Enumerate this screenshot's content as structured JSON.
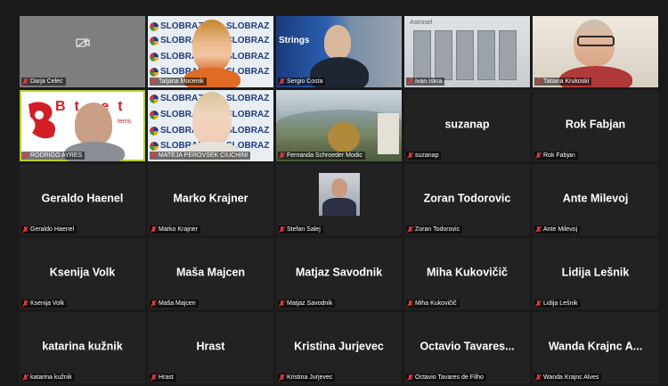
{
  "colors": {
    "active_border": "#b5d12a",
    "muted_mic": "#e03a3a",
    "tile_bg": "#222222"
  },
  "tiles": [
    {
      "id": "darja",
      "name": "Darja Celec",
      "label": "Darja Celec",
      "video": "camera-off"
    },
    {
      "id": "tatjana",
      "name": "Tatjana Mocenik",
      "label": "Tatjana Mocenik",
      "video": "slobraz"
    },
    {
      "id": "sergio",
      "name": "Sergio Costa",
      "label": "Sergio Costa",
      "video": "strings"
    },
    {
      "id": "ivan",
      "name": "Ivan Iskra",
      "label": "Ivan Iskra",
      "video": "lab"
    },
    {
      "id": "tatiana",
      "name": "Tatiana Krukoski",
      "label": "Tatiana Krukoski",
      "video": "person"
    },
    {
      "id": "rodrigo",
      "name": "RODRIGO AYRES",
      "label": "RODRIGO AYRES",
      "video": "logo",
      "active": true
    },
    {
      "id": "mateja",
      "name": "MATEJA PEROVSEK CIUCHINI",
      "label": "MATEJA PEROVSEK CIUCHINI",
      "video": "slobraz"
    },
    {
      "id": "fernanda",
      "name": "Fernanda Schroeder Modic",
      "label": "Fernanda Schroeder Modic",
      "video": "landscape"
    },
    {
      "id": "suzanap",
      "name": "suzanap",
      "label": "suzanap"
    },
    {
      "id": "rok",
      "name": "Rok Fabjan",
      "label": "Rok Fabjan"
    },
    {
      "id": "geraldo",
      "name": "Geraldo Haenel",
      "label": "Geraldo Haenel"
    },
    {
      "id": "marko",
      "name": "Marko Krajner",
      "label": "Marko Krajner"
    },
    {
      "id": "stefan",
      "name": "Stefan Salej",
      "label": "Stefan Salej",
      "video": "photo"
    },
    {
      "id": "zoran",
      "name": "Zoran Todorovic",
      "label": "Zoran Todorovic"
    },
    {
      "id": "ante",
      "name": "Ante Milevoj",
      "label": "Ante Milevoj"
    },
    {
      "id": "ksenija",
      "name": "Ksenija Volk",
      "label": "Ksenija Volk"
    },
    {
      "id": "masa",
      "name": "Maša Majcen",
      "label": "Maša Majcen"
    },
    {
      "id": "matjaz",
      "name": "Matjaz Savodnik",
      "label": "Matjaz Savodnik"
    },
    {
      "id": "miha",
      "name": "Miha Kukovičič",
      "label": "Miha Kukovičič"
    },
    {
      "id": "lidija",
      "name": "Lidija Lešnik",
      "label": "Lidija Lešnik"
    },
    {
      "id": "katarina",
      "name": "katarina kužnik",
      "label": "katarina kužnik"
    },
    {
      "id": "hrast",
      "name": "Hrast",
      "label": "Hrast"
    },
    {
      "id": "kristina",
      "name": "Kristina Jurjevec",
      "label": "Kristina Jurjevec"
    },
    {
      "id": "octavio",
      "name": "Octavio Tavares...",
      "label": "Octavio Tavares de Filho"
    },
    {
      "id": "wanda",
      "name": "Wanda Krajnc A...",
      "label": "Wanda Krajnc Alves"
    }
  ],
  "backgrounds": {
    "slobraz_text": "SLOBRAZ",
    "strings_text": "Strings",
    "lab_text": "Astrosel",
    "logo_text": "Bt et",
    "logo_sub": "tems"
  }
}
